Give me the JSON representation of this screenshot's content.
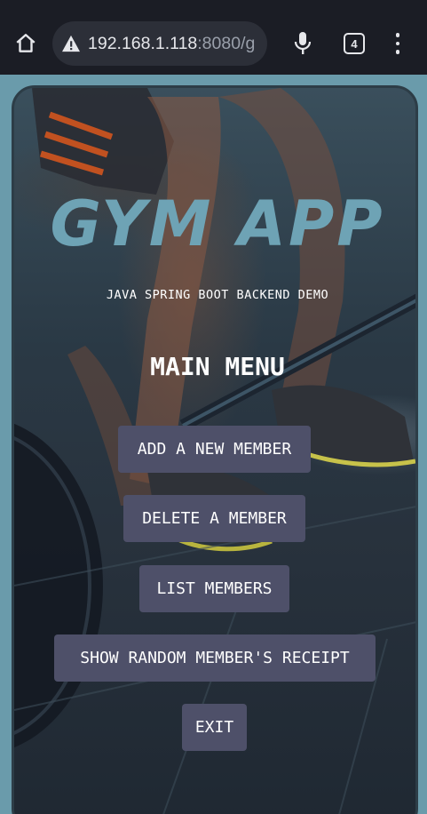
{
  "browser": {
    "url_host": "192.168.1.118",
    "url_rest": ":8080/g",
    "tab_count": "4",
    "icons": [
      "home-icon",
      "warning-icon",
      "microphone-icon",
      "tabs-icon",
      "more-vert-icon"
    ]
  },
  "app": {
    "title": "GYM APP",
    "subtitle": "JAVA SPRING BOOT BACKEND DEMO",
    "menu_heading": "MAIN MENU"
  },
  "menu": {
    "add_member": "ADD A NEW MEMBER",
    "delete_member": "DELETE A MEMBER",
    "list_members": "LIST MEMBERS",
    "random_receipt": "SHOW RANDOM MEMBER'S RECEIPT",
    "exit": "EXIT"
  },
  "colors": {
    "page_bg": "#6a9bab",
    "browser_bar": "#1b1d25",
    "title": "#6ea3b5",
    "button_bg": "#4e5069",
    "button_text": "#ffffff"
  }
}
